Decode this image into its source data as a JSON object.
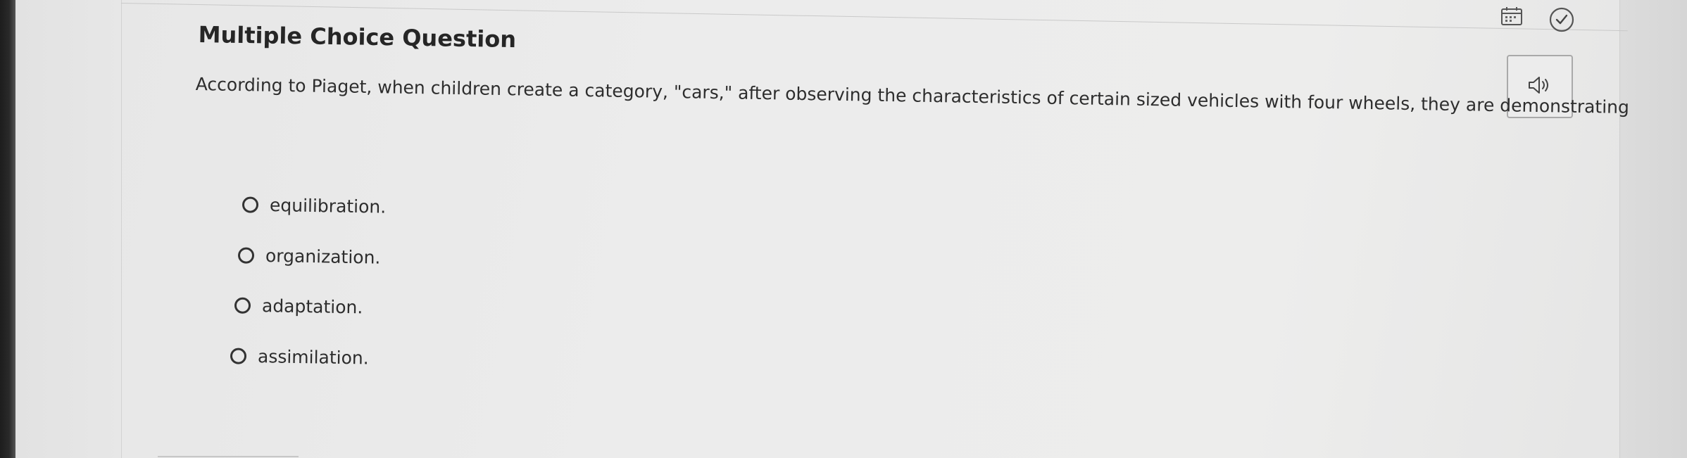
{
  "question": {
    "type_title": "Multiple Choice Question",
    "text": "According to Piaget, when children create a category, \"cars,\" after observing the characteristics of certain sized vehicles with four wheels, they are demonstrating",
    "options": [
      {
        "label": "equilibration.",
        "selected": false
      },
      {
        "label": "organization.",
        "selected": false
      },
      {
        "label": "adaptation.",
        "selected": false
      },
      {
        "label": "assimilation.",
        "selected": false
      }
    ]
  },
  "toolbar": {
    "calendar_icon": "calendar-icon",
    "timer_icon": "clock-check-icon",
    "audio_icon": "speaker-icon"
  },
  "colors": {
    "text": "#2d2d2d",
    "background": "#ececec",
    "border": "#a9a9a9"
  }
}
